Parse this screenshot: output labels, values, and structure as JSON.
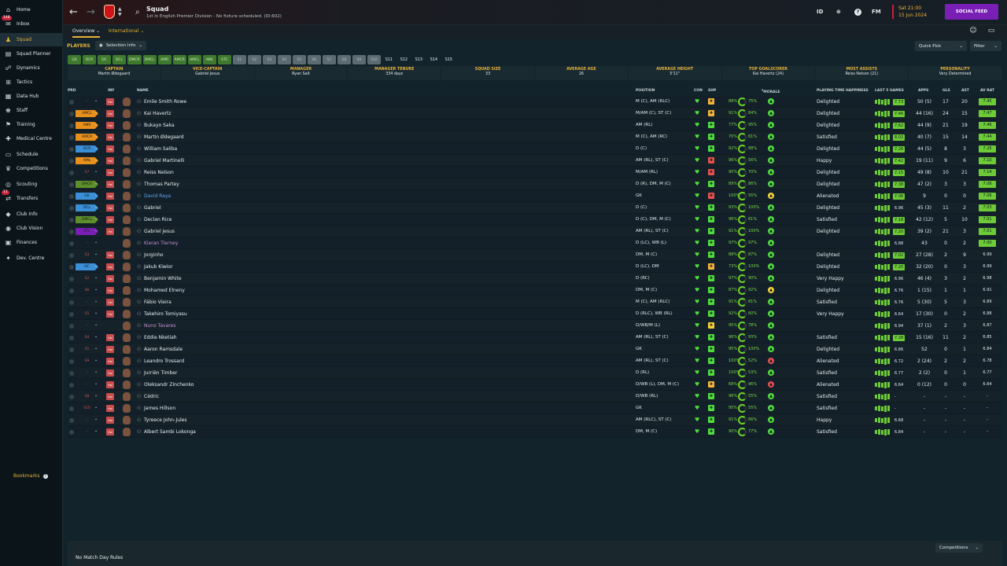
{
  "sidebar": {
    "items": [
      {
        "label": "Home",
        "icon": "home-icon",
        "glyph": "⌂"
      },
      {
        "label": "Inbox",
        "icon": "inbox-icon",
        "glyph": "✉",
        "badge": "148"
      },
      {
        "label": "Squad",
        "icon": "squad-icon",
        "glyph": "♟",
        "active": true
      },
      {
        "label": "Squad Planner",
        "icon": "planner-icon",
        "glyph": "▤"
      },
      {
        "label": "Dynamics",
        "icon": "dynamics-icon",
        "glyph": "☍"
      },
      {
        "label": "Tactics",
        "icon": "tactics-icon",
        "glyph": "⊞"
      },
      {
        "label": "Data Hub",
        "icon": "data-hub-icon",
        "glyph": "▦"
      },
      {
        "label": "Staff",
        "icon": "staff-icon",
        "glyph": "♚"
      },
      {
        "label": "Training",
        "icon": "training-icon",
        "glyph": "⚑"
      },
      {
        "label": "Medical Centre",
        "icon": "medical-icon",
        "glyph": "✚"
      },
      {
        "label": "Schedule",
        "icon": "schedule-icon",
        "glyph": "▭"
      },
      {
        "label": "Competitions",
        "icon": "trophy-icon",
        "glyph": "♛"
      },
      {
        "label": "Scouting",
        "icon": "scouting-icon",
        "glyph": "◎"
      },
      {
        "label": "Transfers",
        "icon": "transfers-icon",
        "glyph": "⇄",
        "badge": "11"
      },
      {
        "label": "Club Info",
        "icon": "club-info-icon",
        "glyph": "◆"
      },
      {
        "label": "Club Vision",
        "icon": "vision-icon",
        "glyph": "◉"
      },
      {
        "label": "Finances",
        "icon": "finances-icon",
        "glyph": "▣"
      },
      {
        "label": "Dev. Centre",
        "icon": "dev-centre-icon",
        "glyph": "✦"
      }
    ],
    "bookmarks_label": "Bookmarks"
  },
  "header": {
    "title": "Squad",
    "subtitle": "1st in English Premier Division - No fixture scheduled. (ID:602)",
    "date_line1": "Sat 21:00",
    "date_line2": "15 Jun 2024",
    "social_feed": "SOCIAL FEED",
    "id_label": "ID",
    "fm_label": "FM"
  },
  "subnav": {
    "overview": "Overview",
    "international": "International"
  },
  "toolbar": {
    "players_label": "PLAYERS",
    "selection_info": "Selection Info",
    "quick_pick": "Quick Pick",
    "filter": "Filter"
  },
  "position_chips": [
    {
      "t": "GK",
      "s": "green"
    },
    {
      "t": "DCR",
      "s": "green"
    },
    {
      "t": "DC",
      "s": "green"
    },
    {
      "t": "DCL",
      "s": "green"
    },
    {
      "t": "DMCR",
      "s": "green"
    },
    {
      "t": "DMCL",
      "s": "green"
    },
    {
      "t": "AMR",
      "s": "green"
    },
    {
      "t": "AMCR",
      "s": "green"
    },
    {
      "t": "AMCL",
      "s": "green"
    },
    {
      "t": "AML",
      "s": "green"
    },
    {
      "t": "STC",
      "s": "green"
    },
    {
      "t": "S1",
      "s": "grey"
    },
    {
      "t": "S2",
      "s": "grey"
    },
    {
      "t": "S3",
      "s": "grey"
    },
    {
      "t": "S4",
      "s": "grey"
    },
    {
      "t": "S5",
      "s": "grey"
    },
    {
      "t": "S6",
      "s": "grey"
    },
    {
      "t": "S7",
      "s": "grey"
    },
    {
      "t": "S8",
      "s": "grey"
    },
    {
      "t": "S9",
      "s": "grey"
    },
    {
      "t": "S10",
      "s": "grey"
    },
    {
      "t": "S11",
      "s": "plain"
    },
    {
      "t": "S12",
      "s": "plain"
    },
    {
      "t": "S13",
      "s": "plain"
    },
    {
      "t": "S14",
      "s": "plain"
    },
    {
      "t": "S15",
      "s": "plain"
    }
  ],
  "summary": [
    {
      "h": "Captain",
      "v": "Martin Ødegaard"
    },
    {
      "h": "Vice-Captain",
      "v": "Gabriel Jesus"
    },
    {
      "h": "Manager",
      "v": "Ryan Salt"
    },
    {
      "h": "Manager Tenure",
      "v": "334 days"
    },
    {
      "h": "Squad Size",
      "v": "33"
    },
    {
      "h": "Average Age",
      "v": "26"
    },
    {
      "h": "Average Height",
      "v": "5'11\""
    },
    {
      "h": "Top Goalscorer",
      "v": "Kai Havertz (24)"
    },
    {
      "h": "Most Assists",
      "v": "Reiss Nelson (21)"
    },
    {
      "h": "Personality",
      "v": "Very Determined"
    }
  ],
  "columns": {
    "prd": "PRD",
    "inf": "INF",
    "name": "NAME",
    "position": "POSITION",
    "con": "CON",
    "shp": "SHP",
    "morale": "MORALE",
    "happiness": "PLAYING TIME HAPPINESS",
    "last5": "LAST 5 GAMES",
    "apps": "APPS",
    "gls": "GLS",
    "ast": "AST",
    "avrat": "AV RAT"
  },
  "colors": {
    "accent": "#e6b13a",
    "brand": "#d0121b",
    "social": "#7a1fb5",
    "good": "#6ccb36"
  },
  "players": [
    {
      "tag": "-",
      "tc": "none",
      "inf": "Hol",
      "name": "Emile Smith Rowe",
      "nc": "",
      "pos": "M (C), AM (RLC)",
      "shp": "#f2b43b",
      "p1": "88%",
      "p2": "75%",
      "mc": "#4fdc3d",
      "hap": "Delighted",
      "f": "7.73",
      "fg": true,
      "apps": "50 (5)",
      "gls": "17",
      "ast": "20",
      "avr": "7.45",
      "ac": "#6ccb36"
    },
    {
      "tag": "AMCL",
      "tc": "#e8901c",
      "inf": "Hol",
      "name": "Kai Havertz",
      "nc": "",
      "pos": "M/AM (C), ST (C)",
      "shp": "#f2b43b",
      "p1": "91%",
      "p2": "84%",
      "mc": "#4fdc3d",
      "hap": "Delighted",
      "f": "7.46",
      "fg": true,
      "apps": "44 (16)",
      "gls": "24",
      "ast": "15",
      "avr": "7.47",
      "ac": "#6ccb36"
    },
    {
      "tag": "AMR",
      "tc": "#e8901c",
      "inf": "Hol",
      "name": "Bukayo Saka",
      "nc": "",
      "pos": "AM (RL)",
      "shp": "#4fdc3d",
      "p1": "77%",
      "p2": "95%",
      "mc": "#4fdc3d",
      "hap": "Delighted",
      "f": "7.62",
      "fg": true,
      "apps": "44 (9)",
      "gls": "21",
      "ast": "19",
      "avr": "7.46",
      "ac": "#6ccb36"
    },
    {
      "tag": "AMCR",
      "tc": "#e8901c",
      "inf": "Hol",
      "name": "Martin Ødegaard",
      "nc": "",
      "pos": "M (C), AM (RC)",
      "shp": "#4fdc3d",
      "p1": "70%",
      "p2": "81%",
      "mc": "#4fdc3d",
      "hap": "Satisfied",
      "f": "8.02",
      "fg": true,
      "apps": "40 (7)",
      "gls": "15",
      "ast": "14",
      "avr": "7.44",
      "ac": "#6ccb36"
    },
    {
      "tag": "DCR",
      "tc": "#3a8fd6",
      "inf": "Hol",
      "name": "William Saliba",
      "nc": "",
      "pos": "D (C)",
      "shp": "#4fdc3d",
      "p1": "92%",
      "p2": "88%",
      "mc": "#4fdc3d",
      "hap": "Delighted",
      "f": "7.26",
      "fg": true,
      "apps": "44 (5)",
      "gls": "8",
      "ast": "3",
      "avr": "7.26",
      "ac": "#6ccb36"
    },
    {
      "tag": "AML",
      "tc": "#e8901c",
      "inf": "Hol",
      "name": "Gabriel Martinelli",
      "nc": "",
      "pos": "AM (RL), ST (C)",
      "shp": "#e55050",
      "p1": "96%",
      "p2": "56%",
      "mc": "#4fdc3d",
      "hap": "Happy",
      "f": "7.42",
      "fg": true,
      "apps": "19 (11)",
      "gls": "9",
      "ast": "6",
      "avr": "7.10",
      "ac": "#6ccb36"
    },
    {
      "tag": "S7",
      "tc": "none",
      "inf": "Hol",
      "name": "Reiss Nelson",
      "nc": "",
      "pos": "M/AM (RL)",
      "shp": "#e55050",
      "p1": "90%",
      "p2": "70%",
      "mc": "#4fdc3d",
      "hap": "Delighted",
      "f": "7.15",
      "fg": true,
      "apps": "49 (8)",
      "gls": "10",
      "ast": "21",
      "avr": "7.14",
      "ac": "#6ccb36"
    },
    {
      "tag": "DMCR",
      "tc": "#5e8f2a",
      "inf": "Hol",
      "name": "Thomas Partey",
      "nc": "",
      "pos": "D (R), DM, M (C)",
      "shp": "#4fdc3d",
      "p1": "89%",
      "p2": "86%",
      "mc": "#4fdc3d",
      "hap": "Delighted",
      "f": "7.38",
      "fg": true,
      "apps": "47 (2)",
      "gls": "3",
      "ast": "3",
      "avr": "7.08",
      "ac": "#6ccb36"
    },
    {
      "tag": "GK",
      "tc": "#3a8fd6",
      "inf": "Hol",
      "name": "David Raya",
      "nc": "blue",
      "pos": "GK",
      "shp": "#e55050",
      "p1": "100%",
      "p2": "55%",
      "mc": "#f2d23b",
      "hap": "Alienated",
      "f": "7.06",
      "fg": true,
      "apps": "9",
      "gls": "0",
      "ast": "0",
      "avr": "7.06",
      "ac": "#6ccb36"
    },
    {
      "tag": "DCL",
      "tc": "#3a8fd6",
      "inf": "Hol",
      "name": "Gabriel",
      "nc": "",
      "pos": "D (C)",
      "shp": "#4fdc3d",
      "p1": "93%",
      "p2": "100%",
      "mc": "#4fdc3d",
      "hap": "Delighted",
      "f": "6.96",
      "fg": false,
      "apps": "45 (3)",
      "gls": "11",
      "ast": "2",
      "avr": "7.03",
      "ac": "#6ccb36"
    },
    {
      "tag": "DMCL",
      "tc": "#5e8f2a",
      "inf": "Hol",
      "name": "Declan Rice",
      "nc": "",
      "pos": "D (C), DM, M (C)",
      "shp": "#4fdc3d",
      "p1": "96%",
      "p2": "81%",
      "mc": "#4fdc3d",
      "hap": "Satisfied",
      "f": "7.18",
      "fg": true,
      "apps": "42 (12)",
      "gls": "5",
      "ast": "10",
      "avr": "7.01",
      "ac": "#6ccb36"
    },
    {
      "tag": "STC",
      "tc": "#7a1fb5",
      "inf": "Hol",
      "name": "Gabriel Jesus",
      "nc": "",
      "pos": "AM (RL), ST (C)",
      "shp": "#4fdc3d",
      "p1": "91%",
      "p2": "100%",
      "mc": "#4fdc3d",
      "hap": "Delighted",
      "f": "7.20",
      "fg": true,
      "apps": "39 (2)",
      "gls": "21",
      "ast": "3",
      "avr": "7.01",
      "ac": "#6ccb36"
    },
    {
      "tag": "-",
      "tc": "none",
      "inf": "",
      "name": "Kieran Tierney",
      "nc": "pink",
      "pos": "D (LC), WB (L)",
      "shp": "#4fdc3d",
      "p1": "97%",
      "p2": "97%",
      "mc": "#4fdc3d",
      "hap": "",
      "f": "6.88",
      "fg": false,
      "apps": "43",
      "gls": "0",
      "ast": "2",
      "avr": "7.00",
      "ac": "#6ccb36"
    },
    {
      "tag": "S3",
      "tc": "none",
      "inf": "Hol",
      "name": "Jorginho",
      "nc": "",
      "pos": "DM, M (C)",
      "shp": "#4fdc3d",
      "p1": "88%",
      "p2": "87%",
      "mc": "#4fdc3d",
      "hap": "Delighted",
      "f": "7.02",
      "fg": true,
      "apps": "27 (28)",
      "gls": "2",
      "ast": "9",
      "avr": "6.99",
      "ac": "none"
    },
    {
      "tag": "DC",
      "tc": "#3a8fd6",
      "inf": "Hol",
      "name": "Jakub Kiwior",
      "nc": "",
      "pos": "D (LC), DM",
      "shp": "#f2b43b",
      "p1": "73%",
      "p2": "100%",
      "mc": "#4fdc3d",
      "hap": "Delighted",
      "f": "7.20",
      "fg": true,
      "apps": "32 (20)",
      "gls": "0",
      "ast": "3",
      "avr": "6.99",
      "ac": "none"
    },
    {
      "tag": "S2",
      "tc": "none",
      "inf": "Hol",
      "name": "Benjamin White",
      "nc": "",
      "pos": "D (RC)",
      "shp": "#4fdc3d",
      "p1": "97%",
      "p2": "90%",
      "mc": "#4fdc3d",
      "hap": "Very Happy",
      "f": "6.96",
      "fg": false,
      "apps": "46 (4)",
      "gls": "3",
      "ast": "2",
      "avr": "6.98",
      "ac": "none"
    },
    {
      "tag": "S6",
      "tc": "none",
      "inf": "Hol",
      "name": "Mohamed Elneny",
      "nc": "",
      "pos": "DM, M (C)",
      "shp": "#4fdc3d",
      "p1": "87%",
      "p2": "92%",
      "mc": "#f2d23b",
      "hap": "Delighted",
      "f": "6.76",
      "fg": false,
      "apps": "1 (15)",
      "gls": "1",
      "ast": "1",
      "avr": "6.91",
      "ac": "none"
    },
    {
      "tag": "-",
      "tc": "none",
      "inf": "Hol",
      "name": "Fábio Vieira",
      "nc": "",
      "pos": "M (C), AM (RLC)",
      "shp": "#4fdc3d",
      "p1": "91%",
      "p2": "81%",
      "mc": "#4fdc3d",
      "hap": "Satisfied",
      "f": "6.76",
      "fg": false,
      "apps": "5 (30)",
      "gls": "5",
      "ast": "3",
      "avr": "6.89",
      "ac": "none"
    },
    {
      "tag": "S5",
      "tc": "none",
      "inf": "Hol",
      "name": "Takehiro Tomiyasu",
      "nc": "",
      "pos": "D (RLC), WB (RL)",
      "shp": "#4fdc3d",
      "p1": "92%",
      "p2": "60%",
      "mc": "#4fdc3d",
      "hap": "Very Happy",
      "f": "6.64",
      "fg": false,
      "apps": "17 (30)",
      "gls": "0",
      "ast": "2",
      "avr": "6.88",
      "ac": "none"
    },
    {
      "tag": "-",
      "tc": "none",
      "inf": "",
      "name": "Nuno Tavares",
      "nc": "pink",
      "pos": "D/WB/M (L)",
      "shp": "#f2d23b",
      "p1": "95%",
      "p2": "78%",
      "mc": "#4fdc3d",
      "hap": "",
      "f": "6.94",
      "fg": false,
      "apps": "37 (1)",
      "gls": "2",
      "ast": "3",
      "avr": "6.87",
      "ac": "none"
    },
    {
      "tag": "S4",
      "tc": "none",
      "inf": "Hol",
      "name": "Eddie Nketiah",
      "nc": "",
      "pos": "AM (RL), ST (C)",
      "shp": "#4fdc3d",
      "p1": "96%",
      "p2": "93%",
      "mc": "#4fdc3d",
      "hap": "Satisfied",
      "f": "7.28",
      "fg": true,
      "apps": "15 (16)",
      "gls": "11",
      "ast": "2",
      "avr": "6.85",
      "ac": "none"
    },
    {
      "tag": "S1",
      "tc": "none",
      "inf": "Hol",
      "name": "Aaron Ramsdale",
      "nc": "",
      "pos": "GK",
      "shp": "#4fdc3d",
      "p1": "95%",
      "p2": "100%",
      "mc": "#4fdc3d",
      "hap": "Delighted",
      "f": "6.86",
      "fg": false,
      "apps": "52",
      "gls": "0",
      "ast": "1",
      "avr": "6.84",
      "ac": "none"
    },
    {
      "tag": "S9",
      "tc": "none",
      "inf": "Hol",
      "name": "Leandro Trossard",
      "nc": "",
      "pos": "AM (RL), ST (C)",
      "shp": "#4fdc3d",
      "p1": "100%",
      "p2": "52%",
      "mc": "#e55050",
      "hap": "Alienated",
      "f": "6.72",
      "fg": false,
      "apps": "2 (24)",
      "gls": "2",
      "ast": "2",
      "avr": "6.78",
      "ac": "none"
    },
    {
      "tag": "-",
      "tc": "none",
      "inf": "Hol",
      "name": "Jurriën Timber",
      "nc": "",
      "pos": "D (RL)",
      "shp": "#4fdc3d",
      "p1": "100%",
      "p2": "53%",
      "mc": "#4fdc3d",
      "hap": "Satisfied",
      "f": "6.77",
      "fg": false,
      "apps": "2 (2)",
      "gls": "0",
      "ast": "1",
      "avr": "6.77",
      "ac": "none"
    },
    {
      "tag": "-",
      "tc": "none",
      "inf": "Hol",
      "name": "Oleksandr Zinchenko",
      "nc": "",
      "pos": "D/WB (L), DM, M (C)",
      "shp": "#f2b43b",
      "p1": "68%",
      "p2": "96%",
      "mc": "#e55050",
      "hap": "Alienated",
      "f": "6.64",
      "fg": false,
      "apps": "0 (12)",
      "gls": "0",
      "ast": "0",
      "avr": "6.64",
      "ac": "none"
    },
    {
      "tag": "S8",
      "tc": "none",
      "inf": "Hol",
      "name": "Cédric",
      "nc": "",
      "pos": "D/WB (RL)",
      "shp": "#4fdc3d",
      "p1": "96%",
      "p2": "55%",
      "mc": "#4fdc3d",
      "hap": "Satisfied",
      "f": "-",
      "fg": false,
      "apps": "-",
      "gls": "-",
      "ast": "-",
      "avr": "-",
      "ac": "none"
    },
    {
      "tag": "S10",
      "tc": "none",
      "inf": "Hol",
      "name": "James Hillson",
      "nc": "",
      "pos": "GK",
      "shp": "#4fdc3d",
      "p1": "95%",
      "p2": "55%",
      "mc": "#4fdc3d",
      "hap": "Satisfied",
      "f": "-",
      "fg": false,
      "apps": "-",
      "gls": "-",
      "ast": "-",
      "avr": "-",
      "ac": "none"
    },
    {
      "tag": "-",
      "tc": "none",
      "inf": "Hol",
      "name": "Tyreece John-Jules",
      "nc": "",
      "pos": "AM (RLC), ST (C)",
      "shp": "#4fdc3d",
      "p1": "91%",
      "p2": "66%",
      "mc": "#4fdc3d",
      "hap": "Happy",
      "f": "6.68",
      "fg": false,
      "apps": "-",
      "gls": "-",
      "ast": "-",
      "avr": "-",
      "ac": "none"
    },
    {
      "tag": "-",
      "tc": "none",
      "inf": "Hol",
      "name": "Albert Sambi Lokonga",
      "nc": "",
      "pos": "DM, M (C)",
      "shp": "#4fdc3d",
      "p1": "90%",
      "p2": "77%",
      "mc": "#4fdc3d",
      "hap": "Satisfied",
      "f": "6.84",
      "fg": false,
      "apps": "-",
      "gls": "-",
      "ast": "-",
      "avr": "-",
      "ac": "none"
    }
  ],
  "footer": {
    "no_match": "No Match Day Rules",
    "competitions": "Competitions"
  }
}
